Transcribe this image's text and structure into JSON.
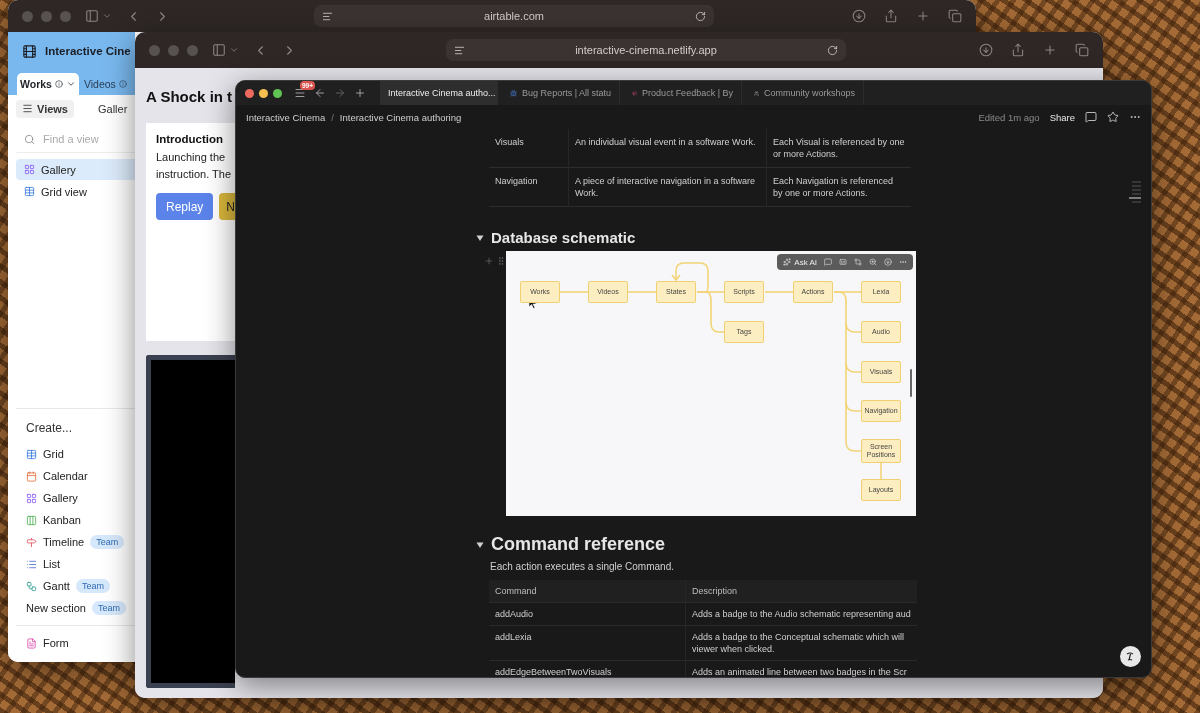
{
  "back_window": {
    "address": "airtable.com",
    "base_title": "Interactive Cine",
    "tabs": [
      {
        "label": "Works",
        "selected": true
      },
      {
        "label": "Videos",
        "selected": false
      }
    ],
    "views_button": "Views",
    "current_view": "Galler",
    "search": {
      "placeholder": "Find a view"
    },
    "views": [
      {
        "label": "Gallery",
        "kind": "gallery",
        "selected": true
      },
      {
        "label": "Grid view",
        "kind": "grid",
        "selected": false
      }
    ],
    "create_heading": "Create...",
    "create_items": [
      {
        "label": "Grid",
        "kind": "grid"
      },
      {
        "label": "Calendar",
        "kind": "calendar"
      },
      {
        "label": "Gallery",
        "kind": "gallery"
      },
      {
        "label": "Kanban",
        "kind": "kanban"
      },
      {
        "label": "Timeline",
        "kind": "timeline",
        "badge": "Team"
      },
      {
        "label": "List",
        "kind": "list"
      },
      {
        "label": "Gantt",
        "kind": "gantt",
        "badge": "Team"
      },
      {
        "label": "New section",
        "kind": "section",
        "badge": "Team"
      },
      {
        "label": "Form",
        "kind": "form"
      }
    ]
  },
  "middle_window": {
    "address": "interactive-cinema.netlify.app",
    "heading": "A Shock in t",
    "card": {
      "title": "Introduction",
      "lines": [
        "Launching the",
        "instruction. The"
      ],
      "buttons": [
        {
          "label": "Replay",
          "kind": "primary"
        },
        {
          "label": "N",
          "kind": "secondary"
        }
      ]
    }
  },
  "front_window": {
    "badge": "99+",
    "tabs": [
      {
        "label": "Interactive Cinema autho...",
        "kind": "page",
        "selected": true
      },
      {
        "label": "Bug Reports | All statu",
        "kind": "bug",
        "selected": false
      },
      {
        "label": "Product Feedback | By",
        "kind": "feedback",
        "selected": false
      },
      {
        "label": "Community workshops",
        "kind": "community",
        "selected": false
      }
    ],
    "breadcrumb": [
      "Interactive Cinema",
      "Interactive Cinema authoring"
    ],
    "breadcrumb_separator": "/",
    "edited": "Edited 1m ago",
    "share": "Share",
    "entity_table": {
      "rows": [
        [
          "Visuals",
          "An individual visual event in a software Work.",
          "Each Visual is referenced by one or more Actions."
        ],
        [
          "Navigation",
          "A piece of interactive navigation in a software Work.",
          "Each Navigation is referenced by one or more Actions."
        ]
      ]
    },
    "schematic": {
      "heading": "Database schematic",
      "expanded": true,
      "toolbar_label": "Ask AI",
      "nodes": [
        {
          "label": "Works"
        },
        {
          "label": "Videos"
        },
        {
          "label": "States"
        },
        {
          "label": "Scripts"
        },
        {
          "label": "Actions"
        },
        {
          "label": "Lexia"
        },
        {
          "label": "Tags"
        },
        {
          "label": "Audio"
        },
        {
          "label": "Visuals"
        },
        {
          "label": "Navigation"
        },
        {
          "label": "Screen Positions"
        },
        {
          "label": "Layouts"
        }
      ]
    },
    "commands": {
      "heading": "Command reference",
      "expanded": true,
      "intro": "Each action executes a single Command.",
      "columns": [
        "Command",
        "Description"
      ],
      "rows": [
        [
          "addAudio",
          "Adds a badge to the Audio schematic representing aud"
        ],
        [
          "addLexia",
          "Adds a badge to the Conceptual schematic which will\nviewer when clicked."
        ],
        [
          "addEdgeBetweenTwoVisuals",
          "Adds an animated line between two badges in the Scr"
        ]
      ]
    }
  }
}
